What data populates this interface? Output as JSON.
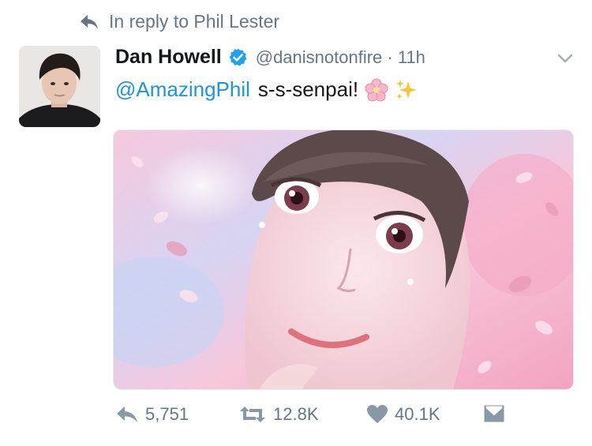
{
  "reply_context": {
    "icon": "reply-arrow-icon",
    "text": "In reply to Phil Lester"
  },
  "tweet": {
    "author_name": "Dan Howell",
    "verified": true,
    "handle_time": "@danisnotonfire · 11h",
    "mention": "@AmazingPhil",
    "text": "s-s-senpai!",
    "emojis": [
      "cherry-blossom-icon",
      "sparkles-icon"
    ]
  },
  "actions": {
    "reply_count": "5,751",
    "retweet_count": "12.8K",
    "like_count": "40.1K"
  },
  "colors": {
    "link": "#1b95e0",
    "muted": "#657786",
    "verified": "#1da1f2"
  }
}
